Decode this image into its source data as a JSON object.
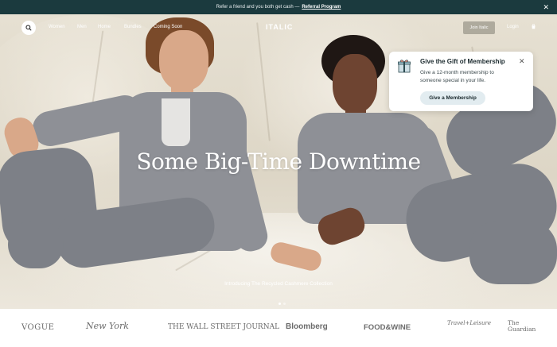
{
  "announcement": {
    "text": "Refer a friend and you both get cash —",
    "link_label": "Referral Program",
    "close_glyph": "✕"
  },
  "nav": {
    "search_icon": "search-icon",
    "links": [
      "Women",
      "Men",
      "Home",
      "Bundles",
      "Coming Soon"
    ],
    "logo": "ITALIC",
    "join_label": "Join Italic",
    "login_label": "Login",
    "cart_icon": "cart-icon"
  },
  "hero": {
    "headline": "Some Big-Time Downtime",
    "subline": "Introducing The Recycled Cashmere Collection",
    "slides": 2,
    "active_slide": 1
  },
  "popup": {
    "icon": "gift-icon",
    "title": "Give the Gift of Membership",
    "body": "Give a 12-month membership to someone special in your life.",
    "cta_label": "Give a Membership",
    "close_glyph": "✕"
  },
  "press": {
    "logos": [
      "VOGUE",
      "New York",
      "THE WALL STREET JOURNAL",
      "Bloomberg",
      "FOOD&WINE",
      "Travel+Leisure",
      "The Guardian"
    ]
  },
  "colors": {
    "announcement_bg": "#1b3a3e",
    "popup_cta_bg": "#e2ecf0",
    "hero_cloth": "#e6e0d2"
  }
}
